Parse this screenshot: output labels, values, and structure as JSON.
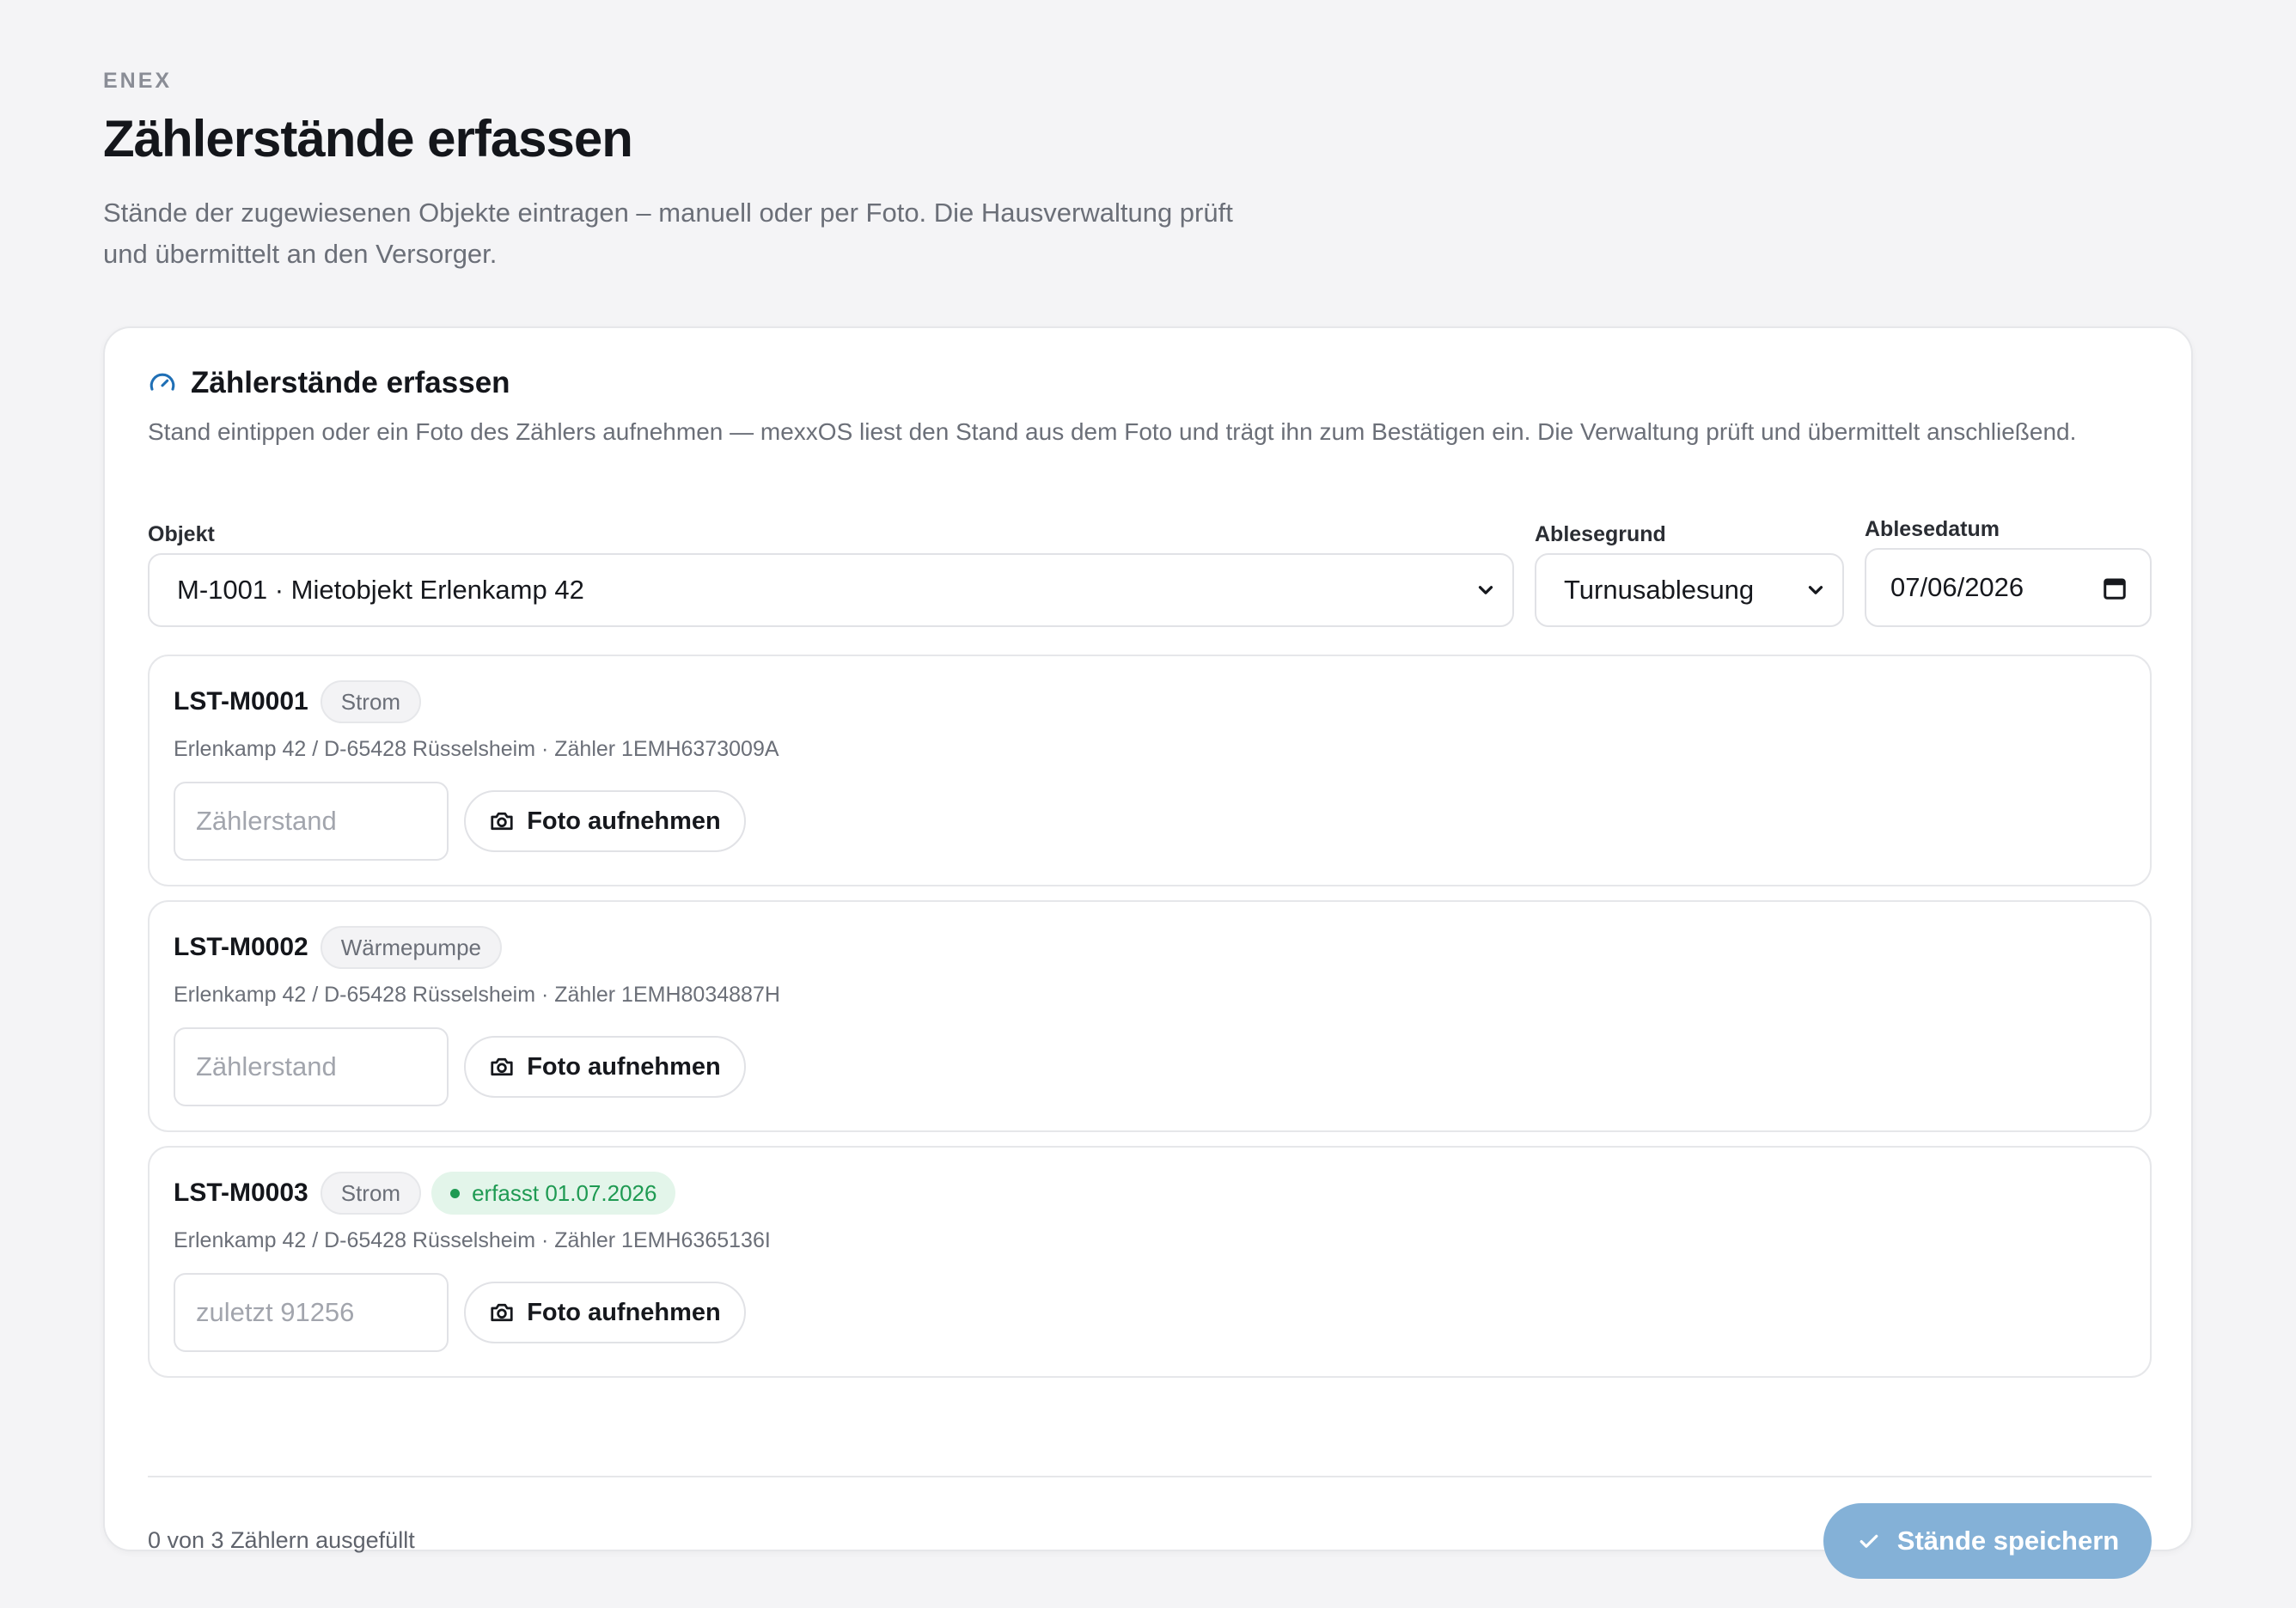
{
  "header": {
    "eyebrow": "ENEX",
    "title": "Zählerstände erfassen",
    "subtitle": "Stände der zugewiesenen Objekte eintragen – manuell oder per Foto. Die Hausverwaltung prüft und übermittelt an den Versorger."
  },
  "card": {
    "title": "Zählerstände erfassen",
    "description": "Stand eintippen oder ein Foto des Zählers aufnehmen — mexxOS liest den Stand aus dem Foto und trägt ihn zum Bestätigen ein. Die Verwaltung prüft und übermittelt anschließend.",
    "icon": "gauge-icon"
  },
  "filters": {
    "objekt_label": "Objekt",
    "objekt_value": "M-1001 · Mietobjekt Erlenkamp 42",
    "grund_label": "Ablesegrund",
    "grund_value": "Turnusablesung",
    "datum_label": "Ablesedatum",
    "datum_value": "07/06/2026"
  },
  "meters": [
    {
      "id": "LST-M0001",
      "type": "Strom",
      "status": "",
      "address": "Erlenkamp 42 / D-65428 Rüsselsheim · Zähler 1EMH6373009A",
      "placeholder": "Zählerstand",
      "photo_label": "Foto aufnehmen"
    },
    {
      "id": "LST-M0002",
      "type": "Wärmepumpe",
      "status": "",
      "address": "Erlenkamp 42 / D-65428 Rüsselsheim · Zähler 1EMH8034887H",
      "placeholder": "Zählerstand",
      "photo_label": "Foto aufnehmen"
    },
    {
      "id": "LST-M0003",
      "type": "Strom",
      "status": "erfasst 01.07.2026",
      "address": "Erlenkamp 42 / D-65428 Rüsselsheim · Zähler 1EMH6365136I",
      "placeholder": "zuletzt 91256",
      "photo_label": "Foto aufnehmen"
    }
  ],
  "footer": {
    "count_text": "0 von 3 Zählern ausgefüllt",
    "save_label": "Stände speichern"
  },
  "colors": {
    "accent": "#1f6fb5",
    "save_button": "#84b1d7",
    "success": "#1e9a52"
  }
}
